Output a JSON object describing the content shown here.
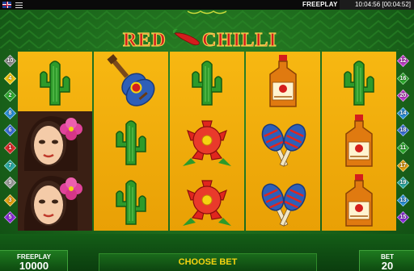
{
  "topbar": {
    "language_icon": "uk-flag-icon",
    "menu_icon": "hamburger-menu-icon",
    "mode": "FREEPLAY",
    "clock": "10:04:56 [00:04:52]"
  },
  "logo": {
    "word_left": "RED",
    "word_right": "CHILLI",
    "icon": "chili-pepper-icon"
  },
  "colors": {
    "reel_background": "#f4b00e",
    "table_green": "#1d6a1c",
    "logo_red": "#d41d1d",
    "accent_yellow": "#f6d410"
  },
  "paylines_left": [
    {
      "number": "10",
      "color": "#8c8c8c"
    },
    {
      "number": "4",
      "color": "#f1c40f"
    },
    {
      "number": "2",
      "color": "#2eaa2e"
    },
    {
      "number": "8",
      "color": "#2a8fd8"
    },
    {
      "number": "6",
      "color": "#3b6fd8"
    },
    {
      "number": "1",
      "color": "#d82a2a"
    },
    {
      "number": "7",
      "color": "#2aa8a0"
    },
    {
      "number": "9",
      "color": "#9d9d9d"
    },
    {
      "number": "3",
      "color": "#e3a10f"
    },
    {
      "number": "5",
      "color": "#8a2ad8"
    }
  ],
  "paylines_right": [
    {
      "number": "12",
      "color": "#c03bc9"
    },
    {
      "number": "16",
      "color": "#2eaa2e"
    },
    {
      "number": "20",
      "color": "#c03bc9"
    },
    {
      "number": "14",
      "color": "#2a8fd8"
    },
    {
      "number": "18",
      "color": "#3b6fd8"
    },
    {
      "number": "11",
      "color": "#2eaa2e"
    },
    {
      "number": "17",
      "color": "#e3a10f"
    },
    {
      "number": "19",
      "color": "#2aa8a0"
    },
    {
      "number": "13",
      "color": "#2a8fd8"
    },
    {
      "number": "15",
      "color": "#8a2ad8"
    }
  ],
  "reels": [
    [
      "cactus",
      "woman",
      "woman"
    ],
    [
      "guitar",
      "cactus",
      "cactus"
    ],
    [
      "cactus",
      "red-flower",
      "red-flower"
    ],
    [
      "tequila-bottle",
      "maracas",
      "maracas"
    ],
    [
      "cactus",
      "tequila-bottle",
      "tequila-bottle"
    ]
  ],
  "bottombar": {
    "credit_label": "FREEPLAY",
    "credit_value": "10000",
    "choose_bet_label": "CHOOSE BET",
    "bet_label": "BET",
    "bet_value": "20"
  }
}
